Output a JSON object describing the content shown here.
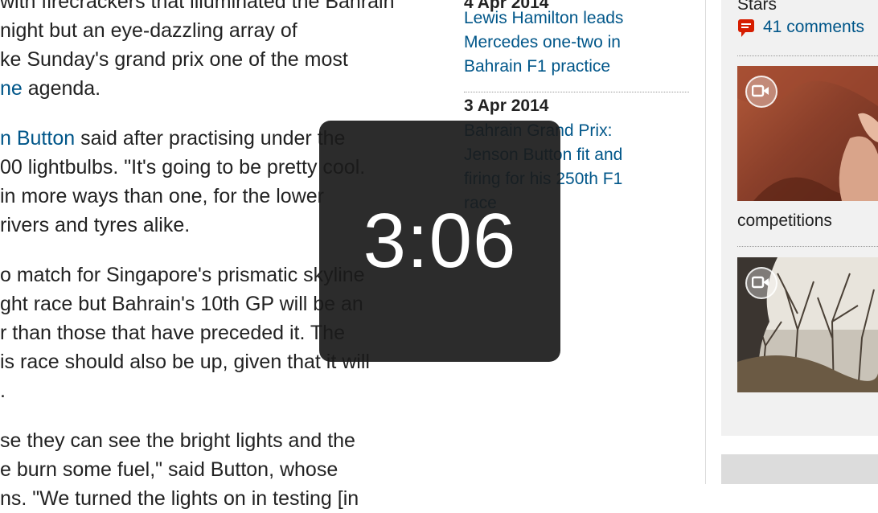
{
  "article": {
    "paragraphs": [
      {
        "lines": [
          {
            "text": "with firecrackers that illuminated the Bahrain",
            "link": null,
            "after": ""
          },
          {
            "text": "night but an eye-dazzling array of",
            "link": null,
            "after": ""
          },
          {
            "text": "ke Sunday's grand prix one of the most",
            "link": null,
            "after": ""
          },
          {
            "text": "",
            "link": "ne",
            "after": " agenda."
          }
        ]
      },
      {
        "lines": [
          {
            "text": "",
            "link": "n Button",
            "after": " said after practising under the"
          },
          {
            "text": "00 lightbulbs. \"It's going to be pretty cool.",
            "link": null,
            "after": ""
          },
          {
            "text": "in more ways than one, for the lower",
            "link": null,
            "after": ""
          },
          {
            "text": "rivers and tyres alike.",
            "link": null,
            "after": ""
          }
        ]
      },
      {
        "lines": [
          {
            "text": "o match for Singapore's prismatic skyline",
            "link": null,
            "after": ""
          },
          {
            "text": "ght race but Bahrain's 10th GP will be an",
            "link": null,
            "after": ""
          },
          {
            "text": "r than those that have preceded it. The",
            "link": null,
            "after": ""
          },
          {
            "text": "is race should also be up, given that it will",
            "link": null,
            "after": ""
          },
          {
            "text": ".",
            "link": null,
            "after": ""
          }
        ]
      },
      {
        "lines": [
          {
            "text": "se they can see the bright lights and the",
            "link": null,
            "after": ""
          },
          {
            "text": "e burn some fuel,\" said Button, whose",
            "link": null,
            "after": ""
          },
          {
            "text": "ns. \"We turned the lights on in testing [in",
            "link": null,
            "after": ""
          }
        ]
      }
    ]
  },
  "related": [
    {
      "date": "4 Apr 2014",
      "headline": [
        "Lewis Hamilton leads",
        "Mercedes one-two in",
        "Bahrain F1 practice"
      ]
    },
    {
      "date": "3 Apr 2014",
      "headline": [
        "Bahrain Grand Prix:",
        "Jenson Button fit and",
        "firing for his 250th F1",
        "race"
      ]
    }
  ],
  "sidebar": {
    "top_text": "Stars",
    "comments": "41 comments",
    "caption": "competitions",
    "video_icon": "video-camera-icon",
    "comment_icon": "speech-bubble-icon"
  },
  "timer": {
    "value": "3:06"
  },
  "colors": {
    "link": "#005689",
    "timer_bg": "#1a1a1a",
    "comment_icon": "#d61d00"
  }
}
